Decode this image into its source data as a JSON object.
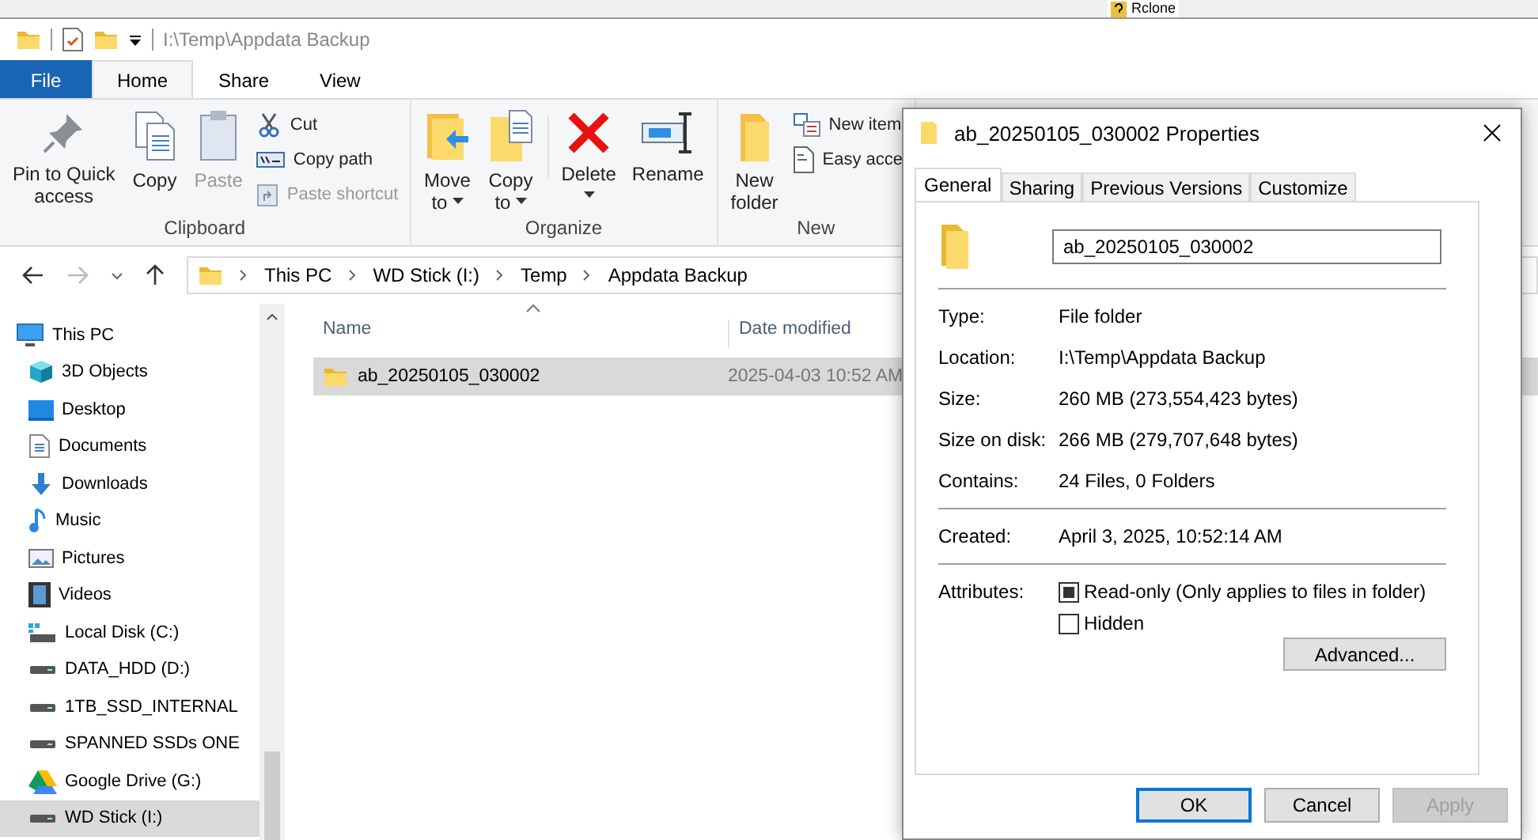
{
  "background_window": {
    "tree_item": "Rclone"
  },
  "window": {
    "title": "I:\\Temp\\Appdata Backup"
  },
  "ribbon_tabs": [
    {
      "label": "File",
      "kind": "file",
      "selected": false
    },
    {
      "label": "Home",
      "kind": "tab",
      "selected": true
    },
    {
      "label": "Share",
      "kind": "tab",
      "selected": false
    },
    {
      "label": "View",
      "kind": "tab",
      "selected": false
    }
  ],
  "ribbon_groups": [
    {
      "label": "Clipboard",
      "items": [
        {
          "kind": "large",
          "label": "Pin to Quick\naccess",
          "disabled": false,
          "dropdown": false
        },
        {
          "kind": "large",
          "label": "Copy",
          "disabled": false,
          "dropdown": false
        },
        {
          "kind": "large",
          "label": "Paste",
          "disabled": true,
          "dropdown": false
        },
        {
          "kind": "small",
          "label": "Cut",
          "disabled": false
        },
        {
          "kind": "small",
          "label": "Copy path",
          "disabled": false
        },
        {
          "kind": "small",
          "label": "Paste shortcut",
          "disabled": true
        }
      ]
    },
    {
      "label": "Organize",
      "items": [
        {
          "kind": "large",
          "label": "Move\nto",
          "disabled": false,
          "dropdown": true
        },
        {
          "kind": "large",
          "label": "Copy\nto",
          "disabled": false,
          "dropdown": true
        },
        {
          "kind": "separator"
        },
        {
          "kind": "large",
          "label": "Delete",
          "disabled": false,
          "dropdown": true
        },
        {
          "kind": "large",
          "label": "Rename",
          "disabled": false,
          "dropdown": false
        }
      ]
    },
    {
      "label": "New",
      "items": [
        {
          "kind": "large",
          "label": "New\nfolder",
          "disabled": false,
          "dropdown": false
        },
        {
          "kind": "small",
          "label": "New item",
          "disabled": false
        },
        {
          "kind": "small",
          "label": "Easy acce",
          "disabled": false
        }
      ]
    }
  ],
  "address_bar": {
    "crumbs": [
      "This PC",
      "WD Stick (I:)",
      "Temp",
      "Appdata Backup"
    ]
  },
  "nav_tree": [
    {
      "label": "This PC",
      "selected": false,
      "children": [
        {
          "label": "3D Objects",
          "selected": false
        },
        {
          "label": "Desktop",
          "selected": false
        },
        {
          "label": "Documents",
          "selected": false
        },
        {
          "label": "Downloads",
          "selected": false
        },
        {
          "label": "Music",
          "selected": false
        },
        {
          "label": "Pictures",
          "selected": false
        },
        {
          "label": "Videos",
          "selected": false
        },
        {
          "label": "Local Disk (C:)",
          "selected": false
        },
        {
          "label": "DATA_HDD (D:)",
          "selected": false
        },
        {
          "label": "1TB_SSD_INTERNAL",
          "selected": false
        },
        {
          "label": "SPANNED SSDs ONE",
          "selected": false
        },
        {
          "label": "Google Drive (G:)",
          "selected": false
        },
        {
          "label": "WD Stick (I:)",
          "selected": true
        }
      ]
    }
  ],
  "file_list": {
    "columns": [
      "Name",
      "Date modified"
    ],
    "rows": [
      {
        "name": "ab_20250105_030002",
        "date_modified": "2025-04-03 10:52 AM",
        "selected": true
      }
    ]
  },
  "dialog": {
    "title": "ab_20250105_030002 Properties",
    "tabs": [
      {
        "label": "General",
        "selected": true
      },
      {
        "label": "Sharing",
        "selected": false
      },
      {
        "label": "Previous Versions",
        "selected": false
      },
      {
        "label": "Customize",
        "selected": false
      }
    ],
    "name_field": {
      "value": "ab_20250105_030002"
    },
    "sections": [
      [
        {
          "label": "Type:",
          "value": "File folder"
        },
        {
          "label": "Location:",
          "value": "I:\\Temp\\Appdata Backup"
        },
        {
          "label": "Size:",
          "value": "260 MB (273,554,423 bytes)"
        },
        {
          "label": "Size on disk:",
          "value": "266 MB (279,707,648 bytes)"
        },
        {
          "label": "Contains:",
          "value": "24 Files, 0 Folders"
        }
      ],
      [
        {
          "label": "Created:",
          "value": "April 3, 2025, 10:52:14 AM"
        }
      ]
    ],
    "attributes_label": "Attributes:",
    "attributes": [
      {
        "label": "Read-only (Only applies to files in folder)",
        "checked": false,
        "indeterminate": true
      },
      {
        "label": "Hidden",
        "checked": false,
        "indeterminate": false
      }
    ],
    "advanced_button": "Advanced...",
    "buttons": [
      {
        "label": "OK",
        "default": true,
        "disabled": false
      },
      {
        "label": "Cancel",
        "default": false,
        "disabled": false
      },
      {
        "label": "Apply",
        "default": false,
        "disabled": true
      }
    ]
  }
}
